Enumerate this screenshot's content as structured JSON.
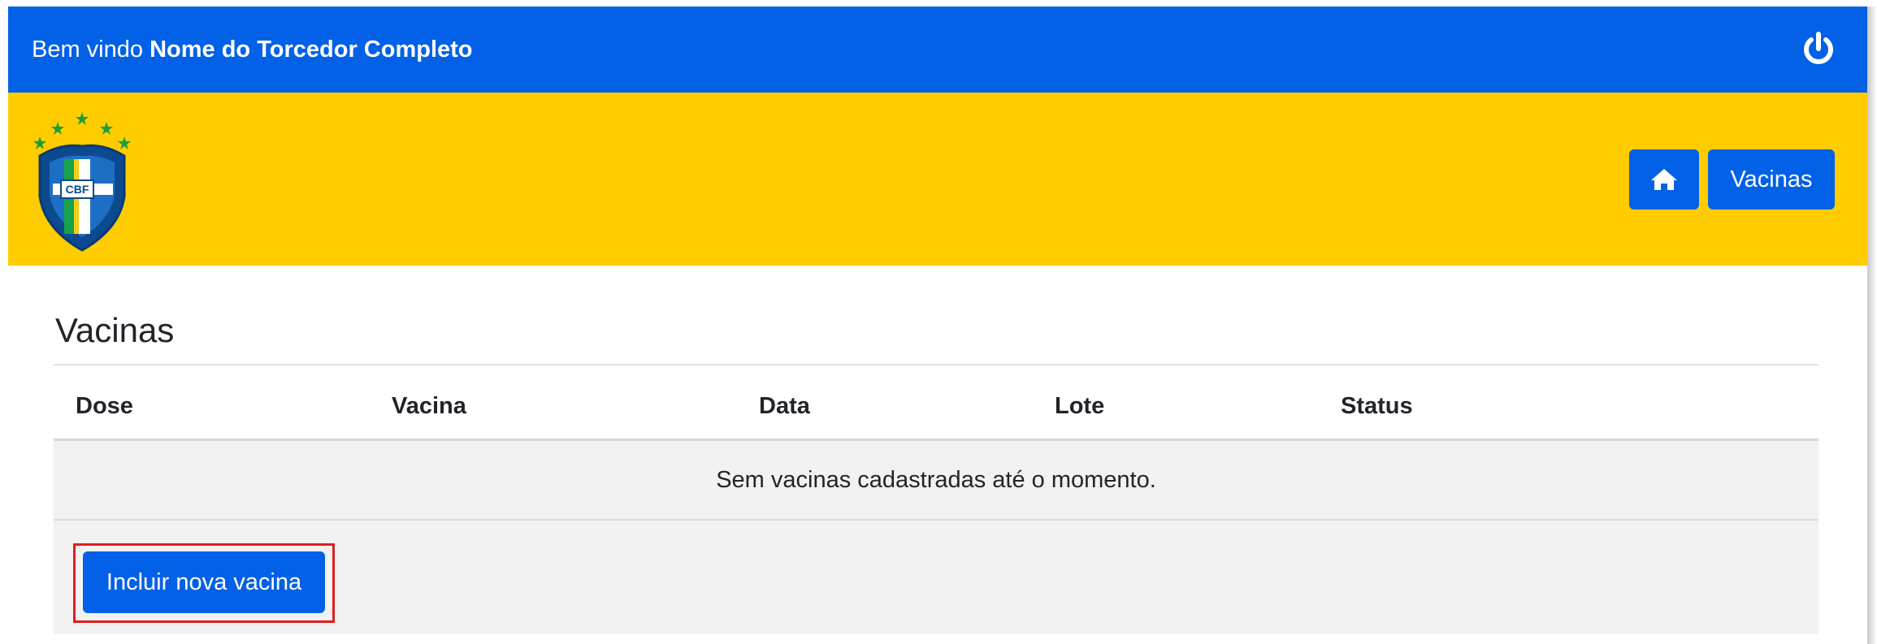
{
  "header": {
    "welcome_prefix": "Bem vindo",
    "user_name": "Nome do Torcedor Completo",
    "power_icon": "power-icon"
  },
  "nav": {
    "logo": "cbf-crest-logo",
    "logo_text": "CBF",
    "home_icon": "home-icon",
    "vacinas_label": "Vacinas"
  },
  "page": {
    "title": "Vacinas"
  },
  "table": {
    "columns": [
      "Dose",
      "Vacina",
      "Data",
      "Lote",
      "Status"
    ],
    "empty_message": "Sem vacinas cadastradas até o momento."
  },
  "actions": {
    "add_label": "Incluir nova vacina"
  },
  "colors": {
    "primary_blue": "#0261e6",
    "band_yellow": "#ffcc00",
    "row_gray": "#f2f2f2",
    "highlight_red": "#e01e1e"
  }
}
